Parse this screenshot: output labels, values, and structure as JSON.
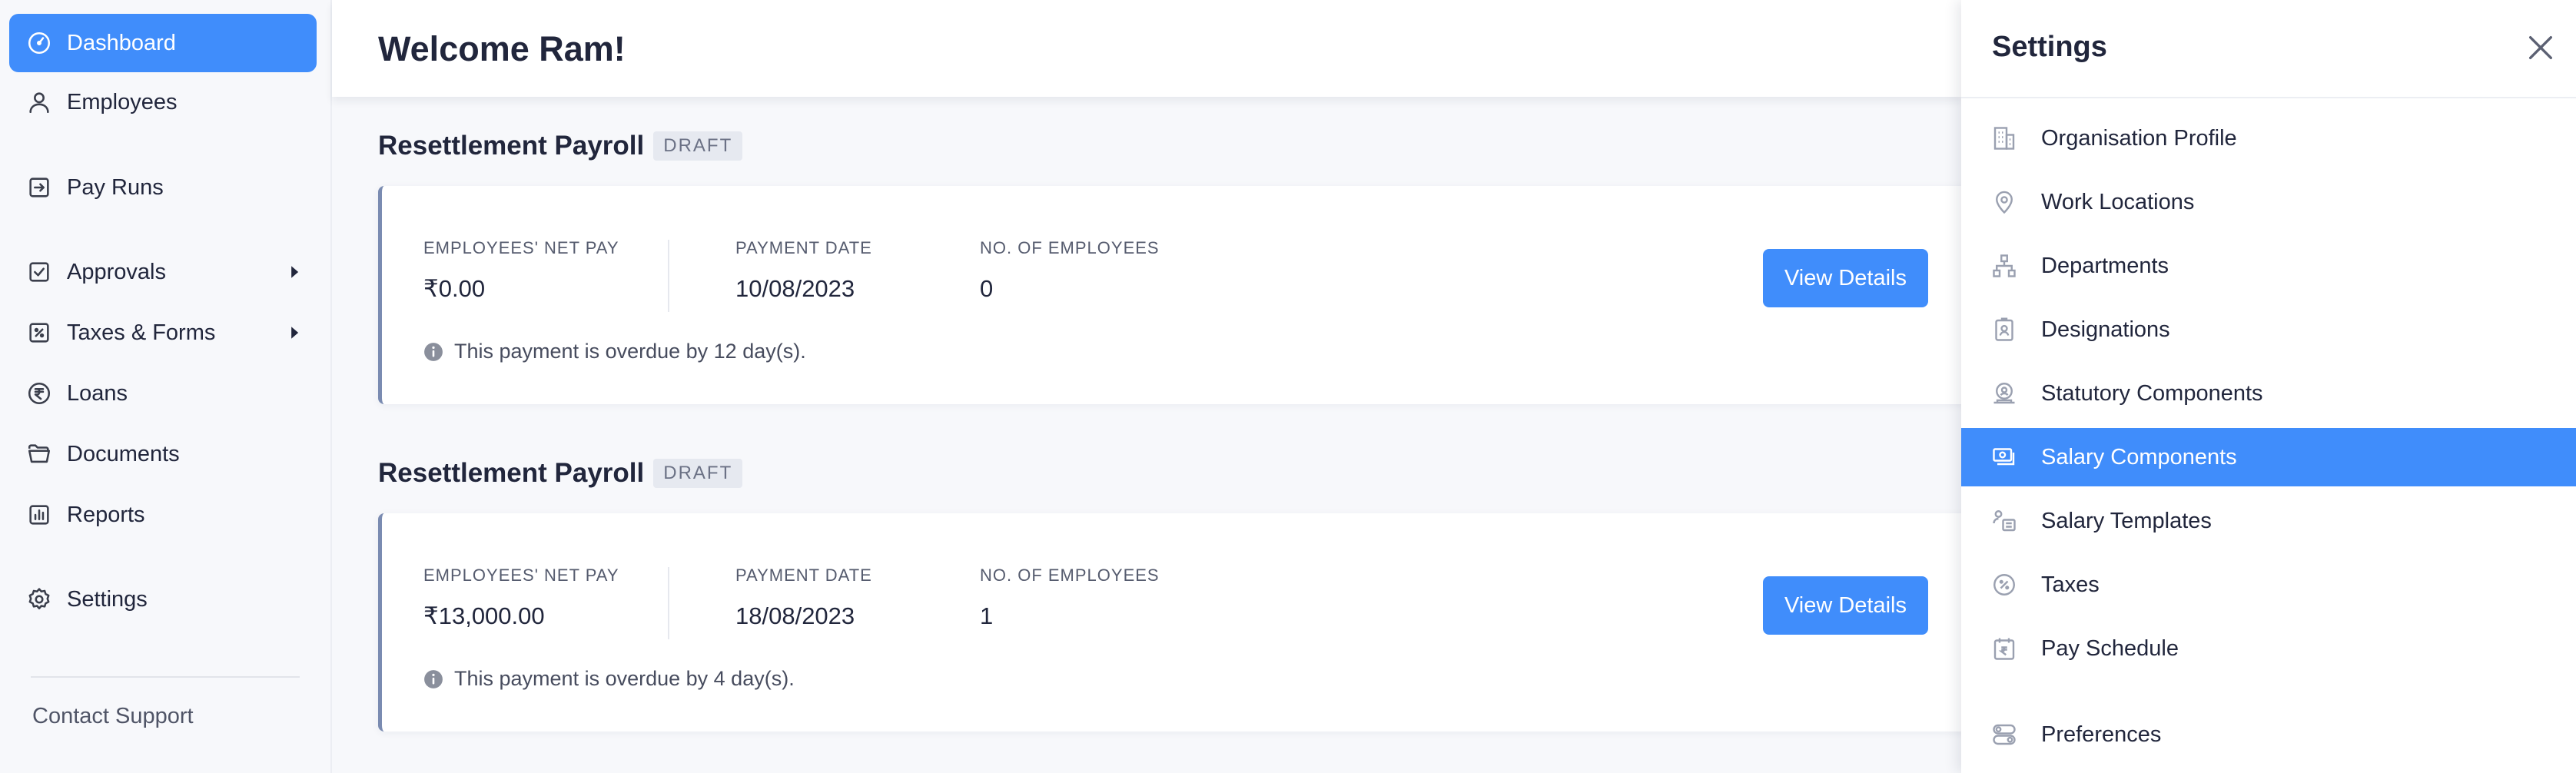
{
  "sidebar": {
    "items": [
      {
        "label": "Dashboard",
        "icon": "dashboard-icon",
        "active": true
      },
      {
        "label": "Employees",
        "icon": "user-icon"
      },
      {
        "label": "Pay Runs",
        "icon": "pay-runs-icon"
      },
      {
        "label": "Approvals",
        "icon": "approvals-icon",
        "expandable": true
      },
      {
        "label": "Taxes & Forms",
        "icon": "taxes-icon",
        "expandable": true
      },
      {
        "label": "Loans",
        "icon": "rupee-icon"
      },
      {
        "label": "Documents",
        "icon": "folder-icon"
      },
      {
        "label": "Reports",
        "icon": "reports-icon"
      },
      {
        "label": "Settings",
        "icon": "gear-icon"
      }
    ],
    "contact_support": "Contact Support"
  },
  "header": {
    "welcome": "Welcome Ram!"
  },
  "payrolls": [
    {
      "title": "Resettlement Payroll",
      "status": "DRAFT",
      "net_pay_label": "EMPLOYEES' NET PAY",
      "net_pay": "₹0.00",
      "payment_date_label": "PAYMENT DATE",
      "payment_date": "10/08/2023",
      "employees_label": "NO. OF EMPLOYEES",
      "employees": "0",
      "overdue_note": "This payment is overdue by 12 day(s).",
      "button": "View Details"
    },
    {
      "title": "Resettlement Payroll",
      "status": "DRAFT",
      "net_pay_label": "EMPLOYEES' NET PAY",
      "net_pay": "₹13,000.00",
      "payment_date_label": "PAYMENT DATE",
      "payment_date": "18/08/2023",
      "employees_label": "NO. OF EMPLOYEES",
      "employees": "1",
      "overdue_note": "This payment is overdue by 4 day(s).",
      "button": "View Details"
    }
  ],
  "settings_panel": {
    "title": "Settings",
    "items": [
      {
        "label": "Organisation Profile",
        "icon": "building-icon"
      },
      {
        "label": "Work Locations",
        "icon": "location-pin-icon"
      },
      {
        "label": "Departments",
        "icon": "org-chart-icon"
      },
      {
        "label": "Designations",
        "icon": "id-badge-icon"
      },
      {
        "label": "Statutory Components",
        "icon": "statutory-icon"
      },
      {
        "label": "Salary Components",
        "icon": "salary-components-icon",
        "active": true
      },
      {
        "label": "Salary Templates",
        "icon": "salary-templates-icon"
      },
      {
        "label": "Taxes",
        "icon": "percent-icon"
      },
      {
        "label": "Pay Schedule",
        "icon": "calendar-rupee-icon"
      },
      {
        "label": "Preferences",
        "icon": "toggles-icon"
      }
    ]
  },
  "colors": {
    "accent": "#408dfb",
    "sidebar_bg": "#f7f8fb",
    "card_border": "#7a8bb1",
    "text": "#21263c"
  }
}
